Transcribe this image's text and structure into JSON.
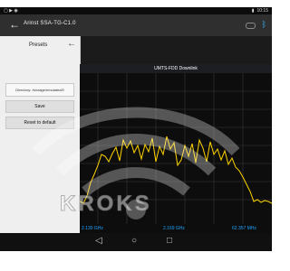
{
  "status": {
    "left_icons": "▢ ▶ ◉",
    "time": "10:15"
  },
  "app": {
    "title": "Arinst SSA-TG-C1.0"
  },
  "presets": {
    "heading": "Presets",
    "directory_label": "Directory: /storage/emulated/0",
    "save_label": "Save",
    "reset_label": "Reset to default"
  },
  "chart": {
    "title": "UMTS-FDD Downlink"
  },
  "footer": {
    "start": "2.130 GHz",
    "center": "2.169 GHz",
    "span": "62.357 MHz"
  },
  "watermark": {
    "text": "KROKS"
  },
  "colors": {
    "trace": "#ffd400",
    "accent": "#1aa4ff",
    "title_bar": "#2f2f2f"
  },
  "icons": [
    "arrow-back-icon",
    "toggle-icon",
    "bluetooth-icon",
    "home-icon",
    "back-nav-icon",
    "recent-apps-icon"
  ]
}
